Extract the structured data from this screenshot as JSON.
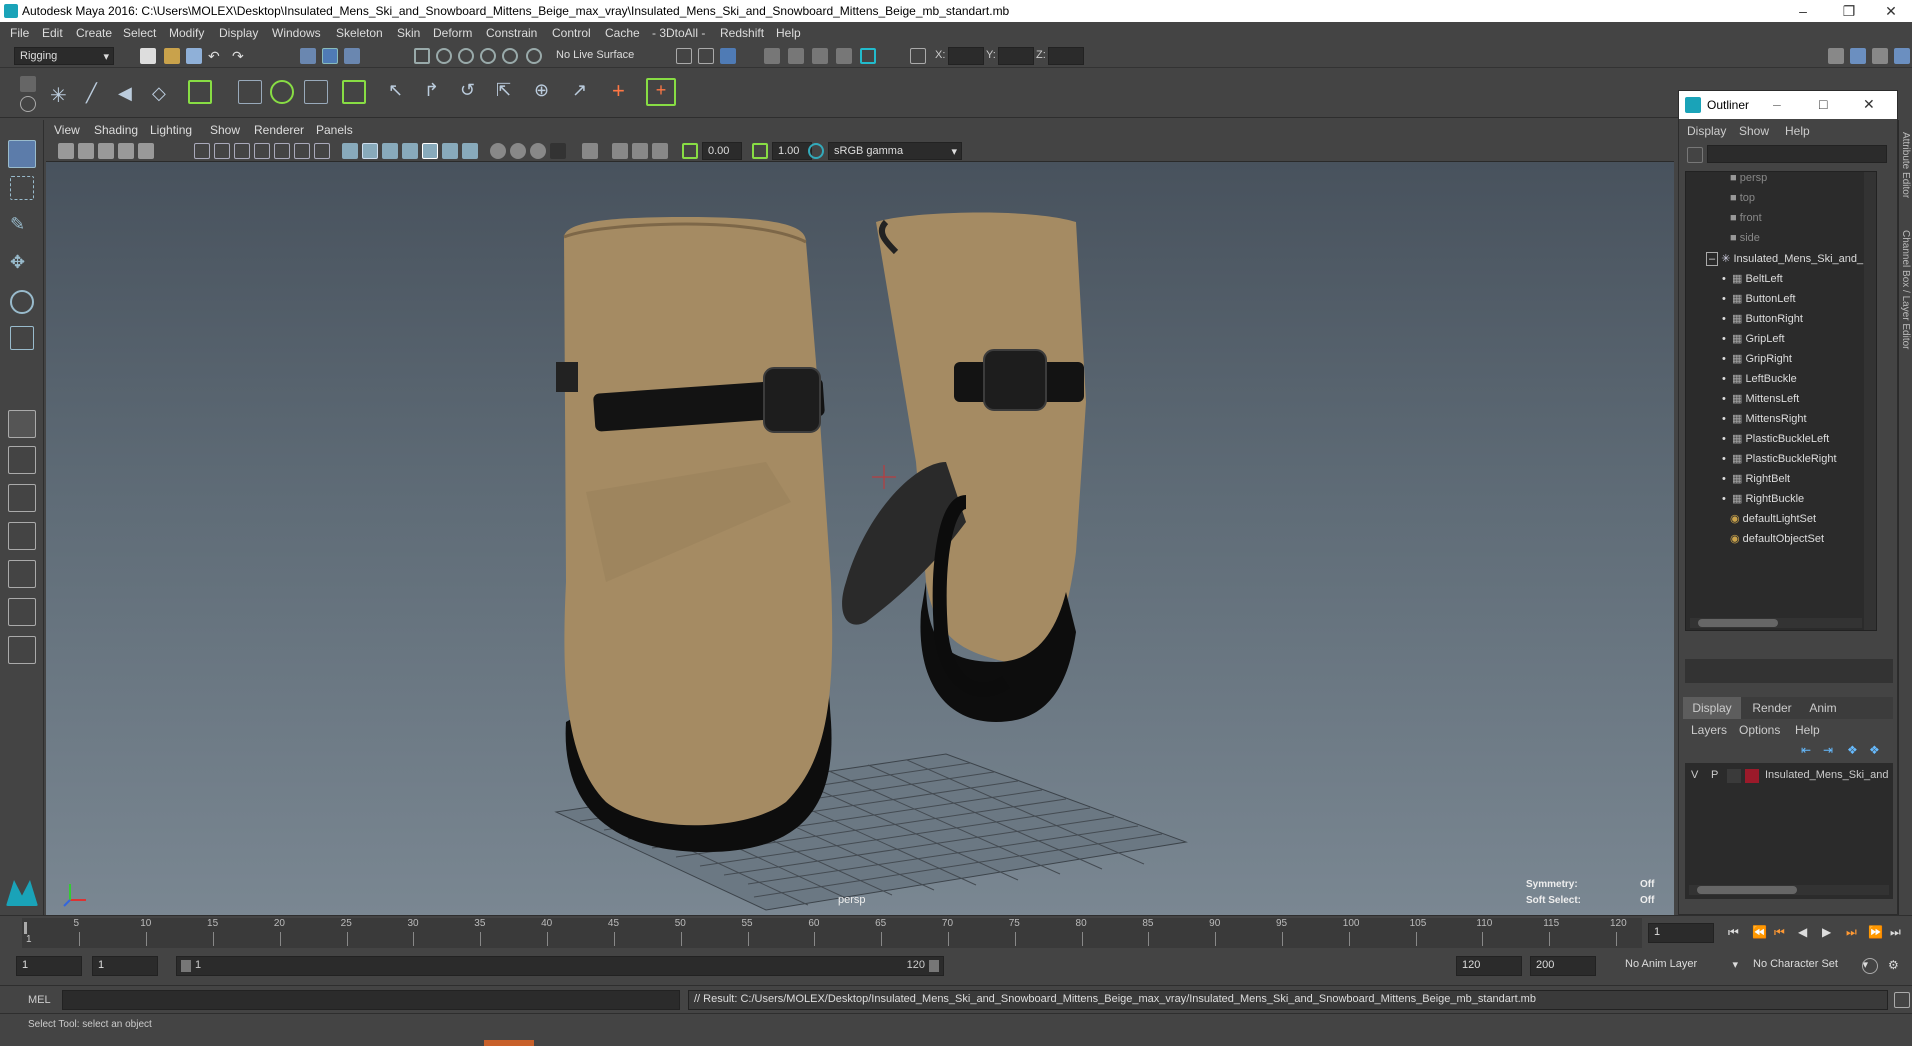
{
  "window": {
    "title": "Autodesk Maya 2016: C:\\Users\\MOLEX\\Desktop\\Insulated_Mens_Ski_and_Snowboard_Mittens_Beige_max_vray\\Insulated_Mens_Ski_and_Snowboard_Mittens_Beige_mb_standart.mb"
  },
  "menubar": [
    "File",
    "Edit",
    "Create",
    "Select",
    "Modify",
    "Display",
    "Windows",
    "Skeleton",
    "Skin",
    "Deform",
    "Constrain",
    "Control",
    "Cache",
    "- 3DtoAll -",
    "Redshift",
    "Help"
  ],
  "statusline": {
    "menu_set": "Rigging",
    "live_surface": "No Live Surface",
    "x_label": "X:",
    "y_label": "Y:",
    "z_label": "Z:"
  },
  "panel_menu": [
    "View",
    "Shading",
    "Lighting",
    "Show",
    "Renderer",
    "Panels"
  ],
  "viewport_toolbar": {
    "exposure": "0.00",
    "gamma": "1.00",
    "color_space": "sRGB gamma"
  },
  "viewport": {
    "camera_label": "persp",
    "symmetry_label": "Symmetry:",
    "symmetry_value": "Off",
    "soft_select_label": "Soft Select:",
    "soft_select_value": "Off"
  },
  "outliner": {
    "title": "Outliner",
    "menu": [
      "Display",
      "Show",
      "Help"
    ],
    "cameras": [
      "persp",
      "top",
      "front",
      "side"
    ],
    "group": "Insulated_Mens_Ski_and_",
    "children": [
      "BeltLeft",
      "ButtonLeft",
      "ButtonRight",
      "GripLeft",
      "GripRight",
      "LeftBuckle",
      "MittensLeft",
      "MittensRight",
      "PlasticBuckleLeft",
      "PlasticBuckleRight",
      "RightBelt",
      "RightBuckle"
    ],
    "sets": [
      "defaultLightSet",
      "defaultObjectSet"
    ]
  },
  "layer_editor": {
    "tabs": [
      "Display",
      "Render",
      "Anim"
    ],
    "menu": [
      "Layers",
      "Options",
      "Help"
    ],
    "layer": {
      "v": "V",
      "p": "P",
      "name": "Insulated_Mens_Ski_and",
      "color": "#9b1a2a"
    }
  },
  "side_tabs": {
    "attribute_editor": "Attribute Editor",
    "channel_box": "Channel Box / Layer Editor"
  },
  "timeslider": {
    "ticks": [
      "5",
      "10",
      "15",
      "20",
      "25",
      "30",
      "35",
      "40",
      "45",
      "50",
      "55",
      "60",
      "65",
      "70",
      "75",
      "80",
      "85",
      "90",
      "95",
      "100",
      "105",
      "110",
      "115",
      "120"
    ],
    "start_tick": "1",
    "current_frame": "1"
  },
  "range": {
    "start": "1",
    "playback_start": "1",
    "slider_start": "1",
    "slider_end": "120",
    "playback_end": "120",
    "end": "200",
    "anim_layer": "No Anim Layer",
    "character_set": "No Character Set"
  },
  "cmdline": {
    "lang": "MEL",
    "result": "// Result: C:/Users/MOLEX/Desktop/Insulated_Mens_Ski_and_Snowboard_Mittens_Beige_max_vray/Insulated_Mens_Ski_and_Snowboard_Mittens_Beige_mb_standart.mb"
  },
  "helpline": {
    "text": "Select Tool: select an object"
  }
}
